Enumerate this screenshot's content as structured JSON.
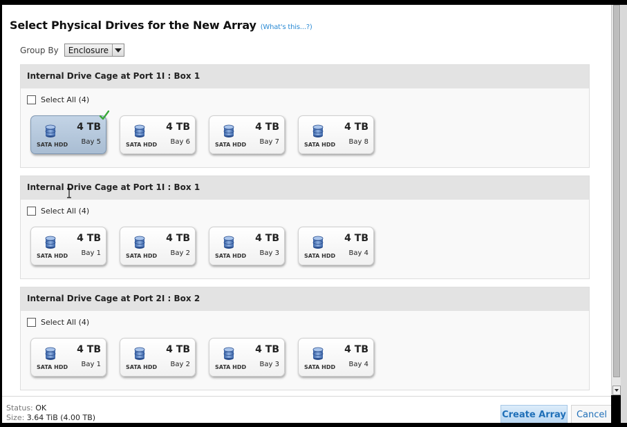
{
  "dialog": {
    "title": "Select Physical Drives for the New Array",
    "help_link": "(What's this...?)"
  },
  "group_by": {
    "label": "Group By",
    "selected": "Enclosure"
  },
  "sections": [
    {
      "header": "Internal Drive Cage at Port 1I : Box 1",
      "select_all": "Select All (4)",
      "drives": [
        {
          "type": "SATA HDD",
          "capacity": "4 TB",
          "bay": "Bay 5",
          "selected": true
        },
        {
          "type": "SATA HDD",
          "capacity": "4 TB",
          "bay": "Bay 6",
          "selected": false
        },
        {
          "type": "SATA HDD",
          "capacity": "4 TB",
          "bay": "Bay 7",
          "selected": false
        },
        {
          "type": "SATA HDD",
          "capacity": "4 TB",
          "bay": "Bay 8",
          "selected": false
        }
      ]
    },
    {
      "header": "Internal Drive Cage at Port 1I : Box 1",
      "select_all": "Select All (4)",
      "drives": [
        {
          "type": "SATA HDD",
          "capacity": "4 TB",
          "bay": "Bay 1",
          "selected": false
        },
        {
          "type": "SATA HDD",
          "capacity": "4 TB",
          "bay": "Bay 2",
          "selected": false
        },
        {
          "type": "SATA HDD",
          "capacity": "4 TB",
          "bay": "Bay 3",
          "selected": false
        },
        {
          "type": "SATA HDD",
          "capacity": "4 TB",
          "bay": "Bay 4",
          "selected": false
        }
      ]
    },
    {
      "header": "Internal Drive Cage at Port 2I : Box 2",
      "select_all": "Select All (4)",
      "drives": [
        {
          "type": "SATA HDD",
          "capacity": "4 TB",
          "bay": "Bay 1",
          "selected": false
        },
        {
          "type": "SATA HDD",
          "capacity": "4 TB",
          "bay": "Bay 2",
          "selected": false
        },
        {
          "type": "SATA HDD",
          "capacity": "4 TB",
          "bay": "Bay 3",
          "selected": false
        },
        {
          "type": "SATA HDD",
          "capacity": "4 TB",
          "bay": "Bay 4",
          "selected": false
        }
      ]
    }
  ],
  "footer": {
    "status_label": "Status:",
    "status_value": "OK",
    "size_label": "Size:",
    "size_value": "3.64 TiB (4.00 TB)",
    "create_button": "Create Array",
    "cancel_button": "Cancel"
  },
  "colors": {
    "accent": "#1f6fb8",
    "selected_drive": "#b3c6db",
    "check": "#3aa83a"
  },
  "icons": [
    "hard-drive-icon",
    "checkmark-icon",
    "dropdown-arrow-icon"
  ]
}
